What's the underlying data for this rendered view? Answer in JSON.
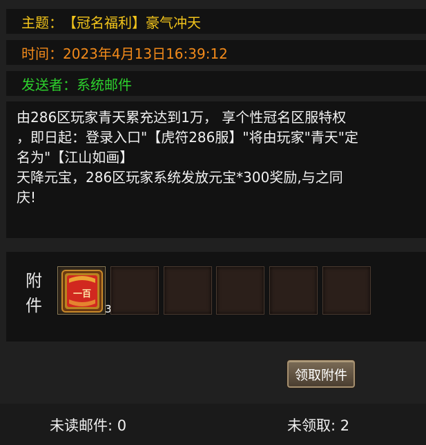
{
  "mail": {
    "subject": {
      "label": "主题：",
      "value": "【冠名福利】豪气冲天"
    },
    "time": {
      "label": "时间：",
      "value": "2023年4月13日16:39:12"
    },
    "sender": {
      "label": "发送者：",
      "value": "系统邮件"
    },
    "body_lines": [
      "由286区玩家青天累充达到1万， 享个性冠名区服特权",
      "，即日起：登录入口\"【虎符286服】\"将由玩家\"青天\"定",
      "名为\"【江山如画】",
      "天降元宝，286区玩家系统发放元宝*300奖励,与之同",
      "庆!"
    ]
  },
  "attachments": {
    "label_line1": "附",
    "label_line2": "件",
    "items": [
      {
        "icon": "red-token-icon",
        "count": "3"
      },
      {
        "icon": "",
        "count": ""
      },
      {
        "icon": "",
        "count": ""
      },
      {
        "icon": "",
        "count": ""
      },
      {
        "icon": "",
        "count": ""
      },
      {
        "icon": "",
        "count": ""
      }
    ],
    "item_glyph": "一百",
    "claim_label": "领取附件"
  },
  "footer": {
    "unread": "未读邮件: 0",
    "unclaimed": "未领取: 2"
  },
  "colors": {
    "subject": "#f2c41b",
    "time": "#f28a1a",
    "sender": "#2dd12d"
  }
}
